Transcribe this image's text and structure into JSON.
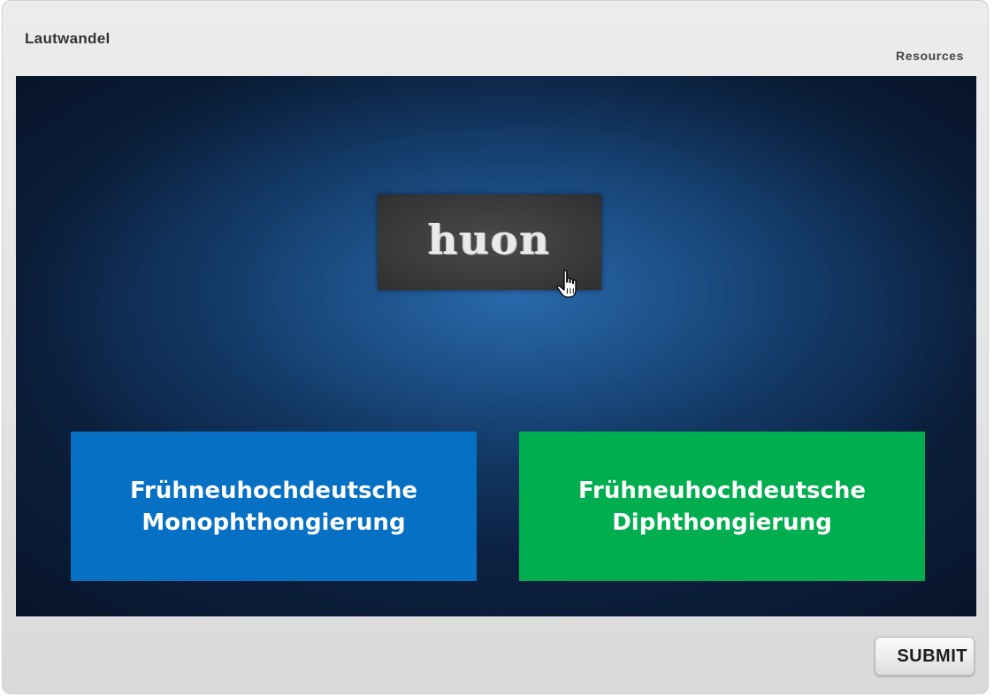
{
  "header": {
    "title": "Lautwandel",
    "resources_label": "Resources"
  },
  "stage": {
    "drag_item": {
      "word": "huon"
    },
    "drop_targets": [
      {
        "label": "Frühneuhochdeutsche\nMonophthongierung",
        "color": "#0670c4"
      },
      {
        "label": "Frühneuhochdeutsche\nDiphthongierung",
        "color": "#00ae4f"
      }
    ],
    "cursor_icon": "hand-pointer-icon"
  },
  "footer": {
    "submit_label": "SUBMIT"
  }
}
